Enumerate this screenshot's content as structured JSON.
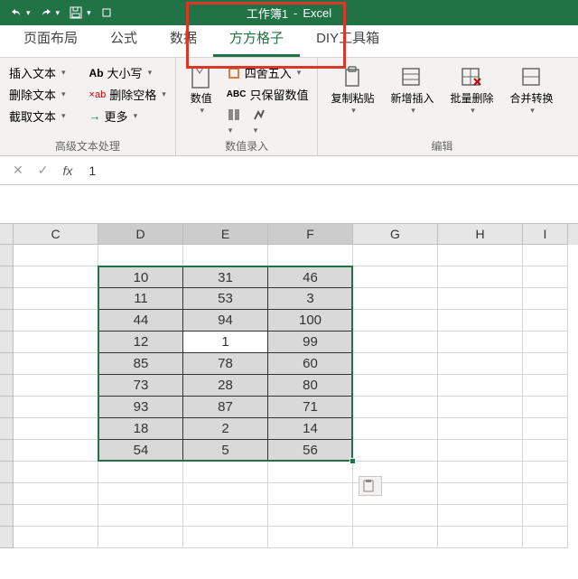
{
  "title": {
    "workbook": "工作簿1",
    "app": "Excel"
  },
  "tabs": [
    {
      "label": "页面布局"
    },
    {
      "label": "公式"
    },
    {
      "label": "数据"
    },
    {
      "label": "方方格子"
    },
    {
      "label": "DIY工具箱"
    }
  ],
  "ribbon": {
    "group1": {
      "label": "高级文本处理",
      "col1": [
        {
          "label": "插入文本"
        },
        {
          "label": "删除文本"
        },
        {
          "label": "截取文本"
        }
      ],
      "col2": [
        {
          "label": "大小写",
          "prefix": "Ab"
        },
        {
          "label": "删除空格",
          "prefix": "×ab"
        },
        {
          "label": "更多",
          "prefix": "→"
        }
      ]
    },
    "group2": {
      "label": "数值录入",
      "big": {
        "label": "数值"
      },
      "col1": [
        {
          "label": "四舍五入",
          "icon": "round"
        },
        {
          "label": "只保留数值",
          "prefix": "ABC"
        }
      ],
      "smallicons": [
        "icon1",
        "icon2"
      ]
    },
    "group3": {
      "label": "编辑",
      "items": [
        {
          "label": "复制粘贴"
        },
        {
          "label": "新增插入"
        },
        {
          "label": "批量删除"
        },
        {
          "label": "合并转换"
        }
      ]
    }
  },
  "formula_bar": {
    "value": "1"
  },
  "columns": [
    "C",
    "D",
    "E",
    "F",
    "G",
    "H",
    "I"
  ],
  "selected_cols": [
    "D",
    "E",
    "F"
  ],
  "active_cell": {
    "col": "E",
    "row": 5
  },
  "chart_data": {
    "type": "table",
    "columns": [
      "D",
      "E",
      "F"
    ],
    "rows": [
      [
        10,
        31,
        46
      ],
      [
        11,
        53,
        3
      ],
      [
        44,
        94,
        100
      ],
      [
        12,
        1,
        99
      ],
      [
        85,
        78,
        60
      ],
      [
        73,
        28,
        80
      ],
      [
        93,
        87,
        71
      ],
      [
        18,
        2,
        14
      ],
      [
        54,
        5,
        56
      ]
    ]
  }
}
